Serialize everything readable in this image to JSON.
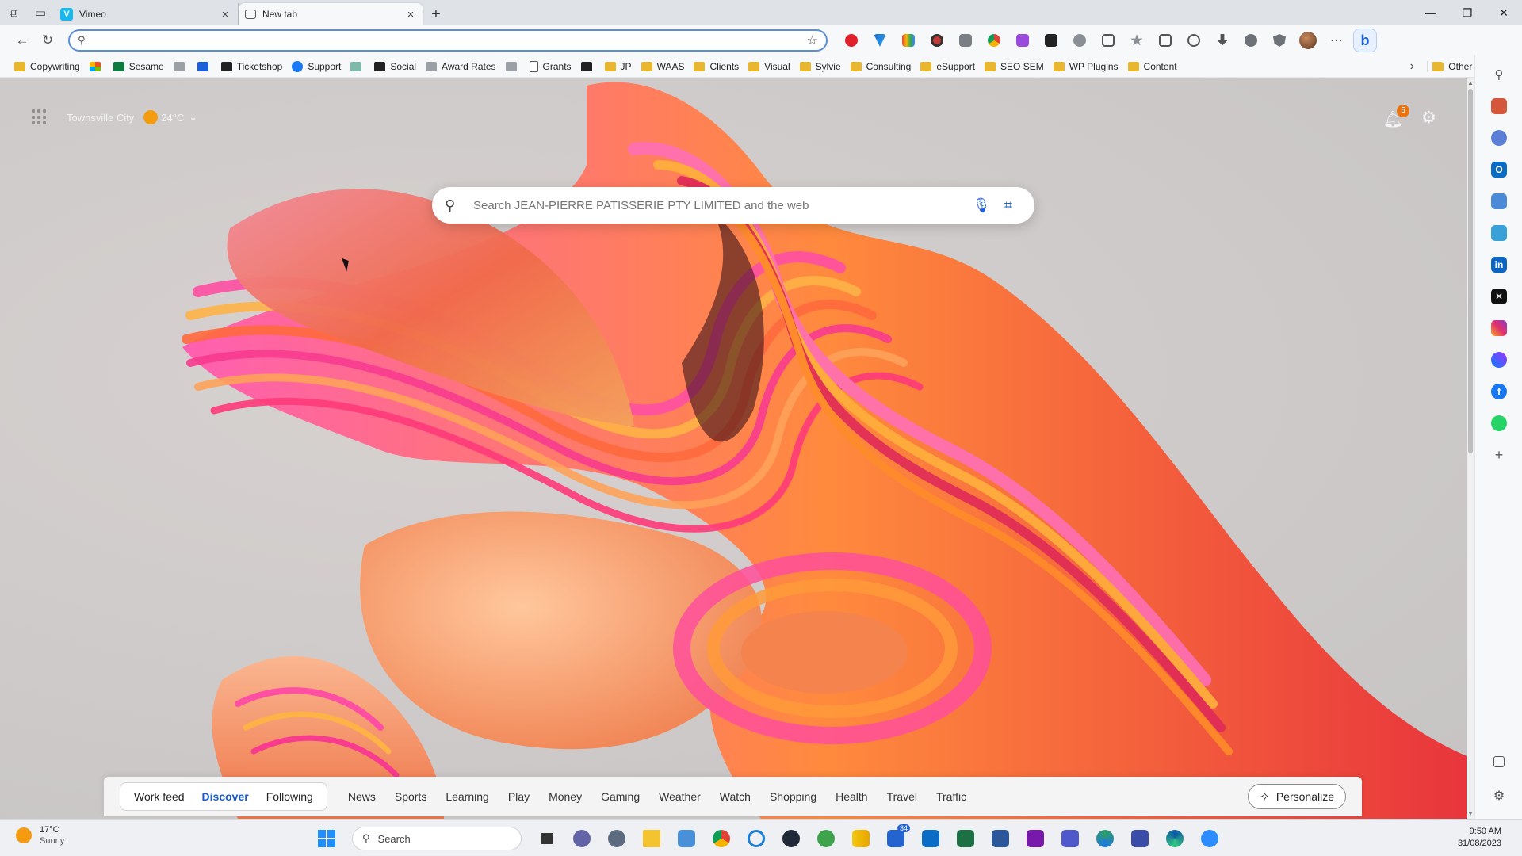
{
  "tabs": [
    {
      "title": "Vimeo",
      "favicon": "vimeo-icon"
    },
    {
      "title": "New tab",
      "favicon": "newtab-icon"
    }
  ],
  "address_bar": {
    "value": "",
    "placeholder": ""
  },
  "favorites": [
    {
      "label": "Copywriting",
      "icon": "folder"
    },
    {
      "label": "",
      "icon": "ms"
    },
    {
      "label": "Sesame",
      "icon": "green"
    },
    {
      "label": "",
      "icon": "grey"
    },
    {
      "label": "",
      "icon": "blue-square"
    },
    {
      "label": "Ticketshop",
      "icon": "dark"
    },
    {
      "label": "Support",
      "icon": "blue"
    },
    {
      "label": "",
      "icon": "teal"
    },
    {
      "label": "Social",
      "icon": "dark"
    },
    {
      "label": "Award Rates",
      "icon": "grey"
    },
    {
      "label": "",
      "icon": "grey"
    },
    {
      "label": "Grants",
      "icon": "doc"
    },
    {
      "label": "",
      "icon": "dark"
    },
    {
      "label": "JP",
      "icon": "folder"
    },
    {
      "label": "WAAS",
      "icon": "folder"
    },
    {
      "label": "Clients",
      "icon": "folder"
    },
    {
      "label": "Visual",
      "icon": "folder"
    },
    {
      "label": "Sylvie",
      "icon": "folder"
    },
    {
      "label": "Consulting",
      "icon": "folder"
    },
    {
      "label": "eSupport",
      "icon": "folder"
    },
    {
      "label": "SEO SEM",
      "icon": "folder"
    },
    {
      "label": "WP Plugins",
      "icon": "folder"
    },
    {
      "label": "Content",
      "icon": "folder"
    }
  ],
  "other_favorites": "Other favorites",
  "newtab": {
    "location": "Townsville City",
    "temperature": "24°C",
    "notification_count": "5",
    "search_placeholder": "Search JEAN-PIERRE PATISSERIE PTY LIMITED and the web"
  },
  "feed": {
    "tabs": [
      "Work feed",
      "Discover",
      "Following"
    ],
    "active_tab": "Discover",
    "categories": [
      "News",
      "Sports",
      "Learning",
      "Play",
      "Money",
      "Gaming",
      "Weather",
      "Watch",
      "Shopping",
      "Health",
      "Travel",
      "Traffic"
    ],
    "personalize": "Personalize"
  },
  "taskbar": {
    "weather_temp": "17°C",
    "weather_desc": "Sunny",
    "search_label": "Search",
    "time": "9:50 AM",
    "date": "31/08/2023",
    "badge": "34"
  },
  "colors": {
    "accent": "#1a5ccf",
    "folder": "#e9b630",
    "tab_bg": "#dfe3e8"
  }
}
